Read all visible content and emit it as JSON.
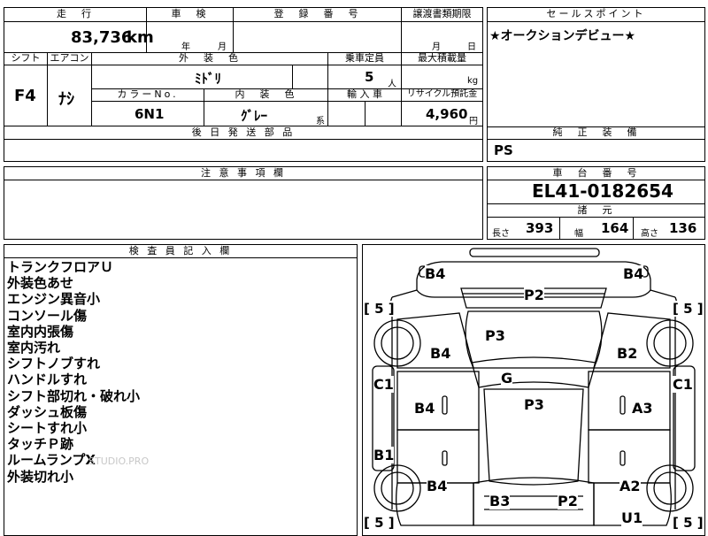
{
  "top": {
    "mileage_header": "走　行",
    "mileage_value": "83,736",
    "mileage_unit": "km",
    "inspection_header": "車　検",
    "inspection_year": "年",
    "inspection_month": "月",
    "registration_header": "登　録　番　号",
    "transfer_header": "譲渡書類期限",
    "transfer_month": "月",
    "transfer_day": "日"
  },
  "sales_point": {
    "header": "セールスポイント",
    "text": "★オークションデビュー★"
  },
  "row2": {
    "shift_header": "シフト",
    "aircon_header": "エアコン",
    "exterior_color_header": "外　装　色",
    "capacity_header": "乗車定員",
    "max_load_header": "最大積載量",
    "shift_value": "F4",
    "aircon_value": "ﾅｼ",
    "exterior_color_value": "ﾐﾄﾞﾘ",
    "capacity_value": "5",
    "capacity_unit": "人",
    "max_load_unit": "kg",
    "color_no_header": "カラーNo.",
    "interior_color_header": "内　装　色",
    "import_header": "輸 入 車",
    "recycle_header": "リサイクル預託金",
    "color_no_value": "6N1",
    "interior_color_value": "ｸﾞﾚｰ",
    "interior_suffix": "系",
    "recycle_value": "4,960",
    "recycle_unit": "円"
  },
  "shipping": {
    "header": "後 日 発 送 部 品"
  },
  "genuine": {
    "header": "純　正　装　備",
    "value": "PS"
  },
  "notes": {
    "header": "注 意 事 項 欄"
  },
  "chassis": {
    "header": "車　台　番　号",
    "value": "EL41-0182654",
    "specs_header": "諸　元",
    "length_label": "長さ",
    "length_value": "393",
    "width_label": "幅",
    "width_value": "164",
    "height_label": "高さ",
    "height_value": "136"
  },
  "inspector": {
    "header": "検 査 員 記 入 欄",
    "items": [
      "トランクフロアＵ",
      "外装色あせ",
      "エンジン異音小",
      "コンソール傷",
      "室内内張傷",
      "室内汚れ",
      "シフトノブすれ",
      "ハンドルすれ",
      "シフト部切れ・破れ小",
      "ダッシュ板傷",
      "シートすれ小",
      "タッチＰ跡",
      "ルームランプX",
      "外装切れ小"
    ]
  },
  "diagram": {
    "tire_labels": [
      "[ 5 ]",
      "[ 5 ]",
      "[ 5 ]",
      "[ 5 ]"
    ],
    "marks": {
      "b4_rear_left": "B4",
      "b4_rear_right": "B4",
      "p2_rear_glass": "P2",
      "p3_roof": "P3",
      "b4_left_quarter": "B4",
      "b2_right_quarter": "B2",
      "c1_left": "C1",
      "c1_right": "C1",
      "g_windshield": "G",
      "b4_left_door": "B4",
      "p3_hood": "P3",
      "a3_right_door": "A3",
      "b1_left": "B1",
      "b4_left_front": "B4",
      "a2_right_front": "A2",
      "b3_front": "B3",
      "p2_front": "P2",
      "u1_right": "U1"
    }
  },
  "watermark": "STUDIO.PRO"
}
